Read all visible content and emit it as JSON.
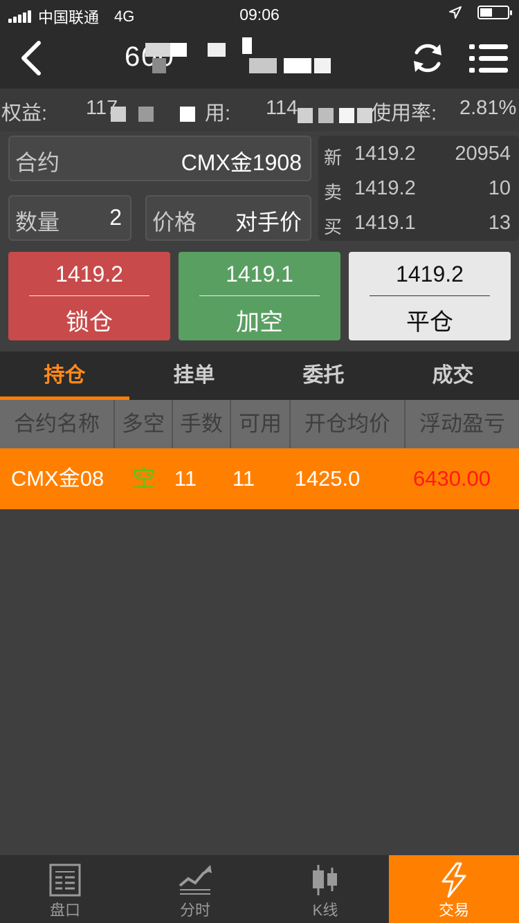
{
  "status": {
    "carrier": "中国联通",
    "network": "4G",
    "time": "09:06"
  },
  "header": {
    "title": "600"
  },
  "account": {
    "equity_label": "权益:",
    "equity_value": "117",
    "available_label": "用:",
    "available_value": "114",
    "usage_label": "使用率:",
    "usage_value": "2.81%"
  },
  "order_form": {
    "contract_label": "合约",
    "contract_value": "CMX金1908",
    "quantity_label": "数量",
    "quantity_value": "2",
    "price_label": "价格",
    "price_value": "对手价"
  },
  "quote": {
    "rows": [
      {
        "key": "新",
        "price": "1419.2",
        "value": "20954"
      },
      {
        "key": "卖",
        "price": "1419.2",
        "value": "10"
      },
      {
        "key": "买",
        "price": "1419.1",
        "value": "13"
      }
    ]
  },
  "buttons": {
    "lock": {
      "price": "1419.2",
      "action": "锁仓"
    },
    "add_short": {
      "price": "1419.1",
      "action": "加空"
    },
    "close": {
      "price": "1419.2",
      "action": "平仓"
    }
  },
  "tabs": [
    "持仓",
    "挂单",
    "委托",
    "成交"
  ],
  "table": {
    "headers": [
      "合约名称",
      "多空",
      "手数",
      "可用",
      "开仓均价",
      "浮动盈亏"
    ],
    "rows": [
      {
        "contract": "CMX金08",
        "direction": "空",
        "lots": "11",
        "available": "11",
        "avg_price": "1425.0",
        "pnl": "6430.00"
      }
    ]
  },
  "tabbar": {
    "items": [
      {
        "label": "盘口",
        "icon": "order-book-icon"
      },
      {
        "label": "分时",
        "icon": "time-share-chart-icon"
      },
      {
        "label": "K线",
        "icon": "candlestick-icon"
      },
      {
        "label": "交易",
        "icon": "lightning-icon"
      }
    ]
  },
  "colors": {
    "accent": "#ff8000",
    "lock_button": "#c84a4a",
    "add_short_button": "#5a9f62",
    "close_button": "#e8e8e8",
    "short_text": "#5ec31a",
    "pnl_text": "#ff1a1a"
  }
}
